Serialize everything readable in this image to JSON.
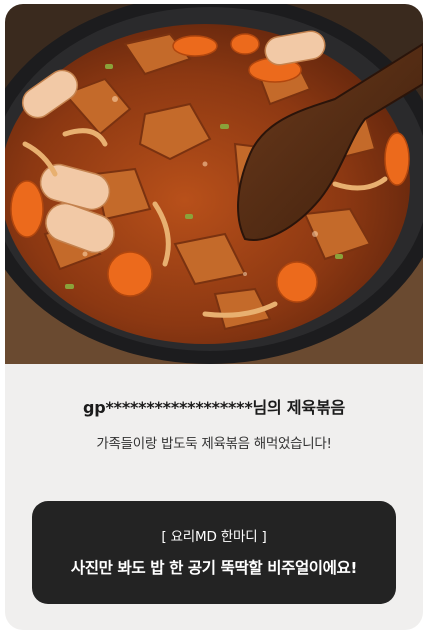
{
  "review_card": {
    "photo_alt": "제육볶음 사진",
    "title": "gp******************님의 제육볶음",
    "review_text": "가족들이랑 밥도둑 제육볶음 해먹었습니다!",
    "md_comment": {
      "label": "[ 요리MD 한마디 ]",
      "text": "사진만 봐도 밥 한 공기 뚝딱할 비주얼이에요!"
    }
  },
  "colors": {
    "card_bg": "#f0efee",
    "md_box_bg": "#232323",
    "title_text": "#1b1b1b"
  }
}
